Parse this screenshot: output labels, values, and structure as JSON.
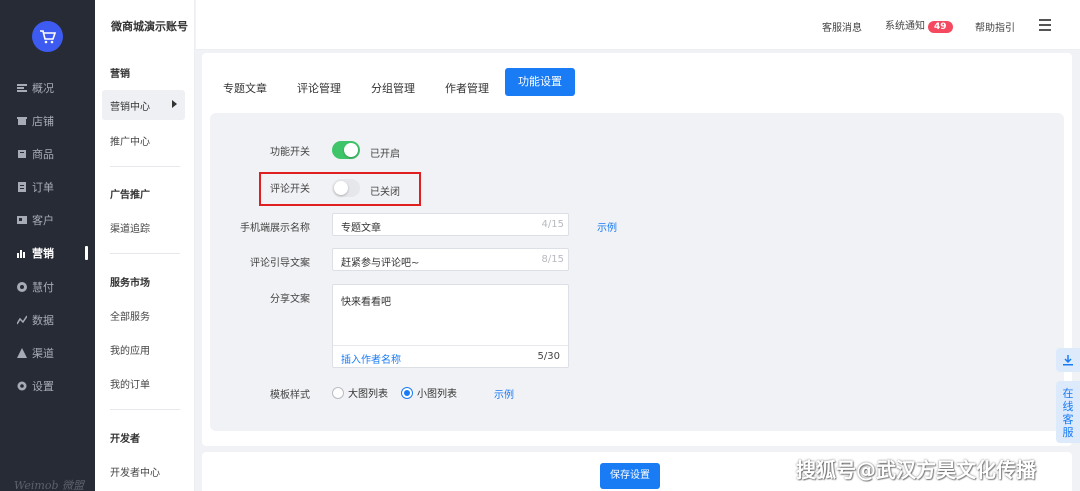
{
  "app": {
    "brand": "Weimob 微盟"
  },
  "nav": {
    "items": [
      {
        "label": "概况",
        "icon": "overview-icon"
      },
      {
        "label": "店铺",
        "icon": "store-icon"
      },
      {
        "label": "商品",
        "icon": "goods-icon"
      },
      {
        "label": "订单",
        "icon": "order-icon"
      },
      {
        "label": "客户",
        "icon": "customer-icon"
      },
      {
        "label": "营销",
        "icon": "marketing-icon",
        "active": true
      },
      {
        "label": "慧付",
        "icon": "pay-icon"
      },
      {
        "label": "数据",
        "icon": "data-icon"
      },
      {
        "label": "渠道",
        "icon": "channel-icon"
      },
      {
        "label": "设置",
        "icon": "settings-icon"
      }
    ]
  },
  "subnav": {
    "shop_title": "微商城演示账号",
    "sections": [
      {
        "head": "营销",
        "links": [
          "营销中心",
          "推广中心"
        ]
      },
      {
        "head": "广告推广",
        "links": [
          "渠道追踪"
        ]
      },
      {
        "head": "服务市场",
        "links": [
          "全部服务",
          "我的应用",
          "我的订单"
        ]
      },
      {
        "head": "开发者",
        "links": [
          "开发者中心"
        ]
      }
    ]
  },
  "header": {
    "service_msg": "客服消息",
    "system_notice": "系统通知",
    "notice_count": "49",
    "help": "帮助指引"
  },
  "tabs": [
    "专题文章",
    "评论管理",
    "分组管理",
    "作者管理",
    "功能设置"
  ],
  "active_tab": "功能设置",
  "form": {
    "feature_switch": {
      "label": "功能开关",
      "status": "已开启",
      "on": true
    },
    "comment_switch": {
      "label": "评论开关",
      "status": "已关闭",
      "on": false
    },
    "mobile_name": {
      "label": "手机端展示名称",
      "value": "专题文章",
      "count": "4/15",
      "example": "示例"
    },
    "comment_guide": {
      "label": "评论引导文案",
      "value": "赶紧参与评论吧~",
      "count": "8/15"
    },
    "share_text": {
      "label": "分享文案",
      "value": "快来看看吧",
      "insert": "插入作者名称",
      "count": "5/30"
    },
    "template": {
      "label": "模板样式",
      "option_large": "大图列表",
      "option_small": "小图列表",
      "selected": "小图列表",
      "example": "示例"
    }
  },
  "save_label": "保存设置",
  "watermark": "搜狐号@武汉方昊文化传播",
  "float": {
    "customer_service": "在线客服"
  },
  "colors": {
    "primary": "#1a7cf5",
    "toggle_on": "#3fc569",
    "badge": "#f5495f",
    "highlight": "#e02020",
    "nav_bg": "#272b35"
  }
}
